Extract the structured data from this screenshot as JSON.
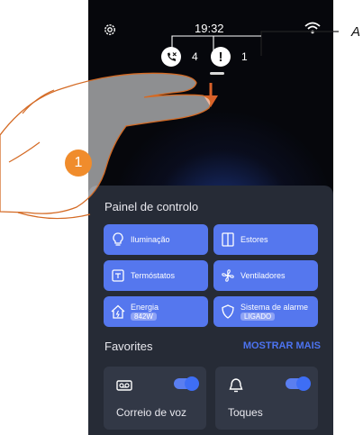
{
  "status_bar": {
    "time": "19:32"
  },
  "notifications": {
    "missed_calls_count": "4",
    "alerts_count": "1"
  },
  "annotations": {
    "callout_letter": "A",
    "step_number": "1"
  },
  "control_panel": {
    "title": "Painel de controlo",
    "buttons": [
      {
        "label": "Iluminação",
        "icon": "bulb-icon"
      },
      {
        "label": "Estores",
        "icon": "shutter-icon"
      },
      {
        "label": "Termóstatos",
        "icon": "thermostat-icon"
      },
      {
        "label": "Ventiladores",
        "icon": "fan-icon"
      },
      {
        "label": "Energia",
        "value": "842W",
        "icon": "energy-icon"
      },
      {
        "label": "Sistema de alarme",
        "value": "LIGADO",
        "icon": "shield-icon"
      }
    ]
  },
  "favorites": {
    "title": "Favorites",
    "show_more": "MOSTRAR MAIS",
    "items": [
      {
        "label": "Correio de voz",
        "icon": "voicemail-icon",
        "enabled": true
      },
      {
        "label": "Toques",
        "icon": "bell-icon",
        "enabled": true
      }
    ]
  },
  "colors": {
    "accent": "#5577ee",
    "panel": "#262b36",
    "step_badge": "#f08c2c"
  }
}
